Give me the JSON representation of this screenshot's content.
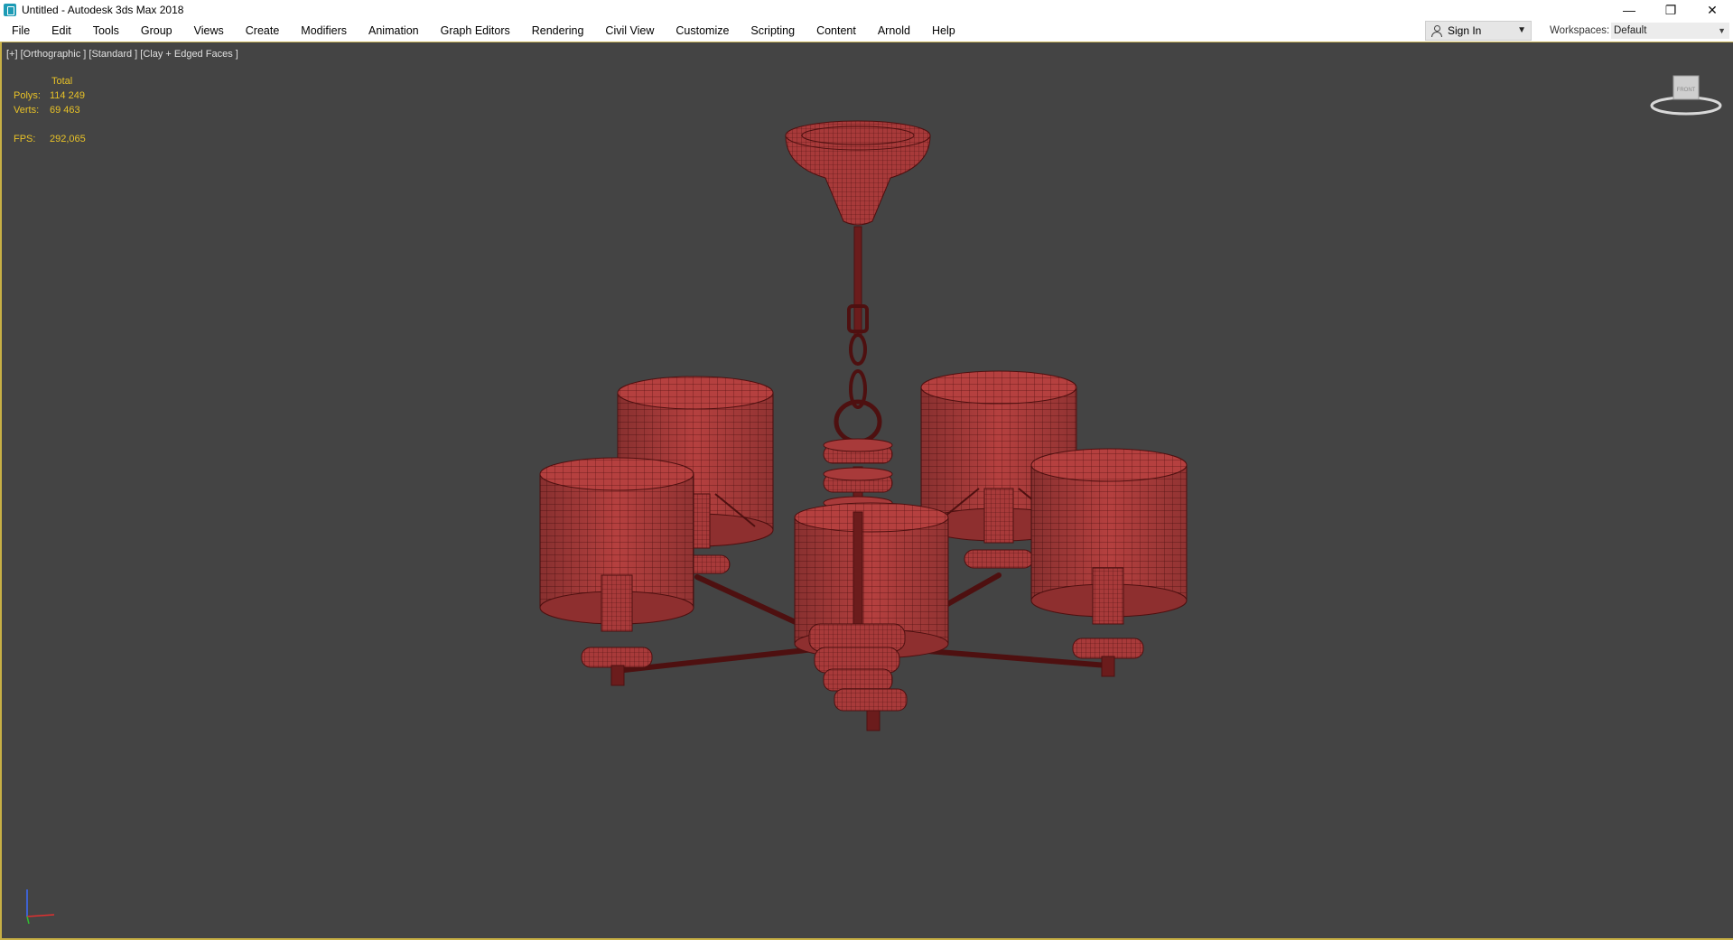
{
  "window": {
    "title": "Untitled - Autodesk 3ds Max 2018",
    "controls": {
      "minimize": "—",
      "restore": "❐",
      "close": "✕"
    }
  },
  "menubar": {
    "items": [
      "File",
      "Edit",
      "Tools",
      "Group",
      "Views",
      "Create",
      "Modifiers",
      "Animation",
      "Graph Editors",
      "Rendering",
      "Civil View",
      "Customize",
      "Scripting",
      "Content",
      "Arnold",
      "Help"
    ],
    "sign_in": "Sign In",
    "workspaces_label": "Workspaces:",
    "workspaces_value": "Default"
  },
  "viewport": {
    "label": "[+] [Orthographic ] [Standard ] [Clay + Edged Faces ]",
    "stats": {
      "header": "Total",
      "polys_label": "Polys:",
      "polys_value": "114 249",
      "verts_label": "Verts:",
      "verts_value": "69 463",
      "fps_label": "FPS:",
      "fps_value": "292,065"
    },
    "viewcube_label": "FRONT"
  },
  "colors": {
    "viewport_bg": "#444444",
    "model_fill": "#b5403f",
    "model_wire": "#5a1414",
    "stats_text": "#e8c227",
    "viewport_border": "#c8b045"
  },
  "icons": [
    "app-icon",
    "user-icon",
    "chevron-down-icon",
    "minimize-icon",
    "restore-icon",
    "close-icon",
    "viewcube-icon",
    "axis-tripod-icon"
  ]
}
